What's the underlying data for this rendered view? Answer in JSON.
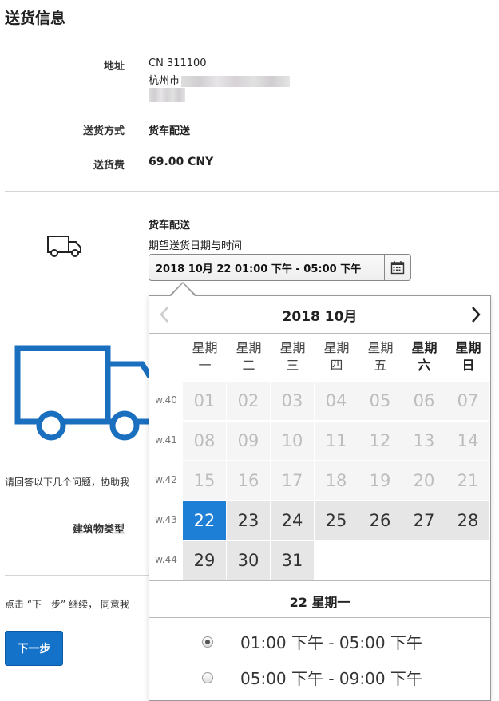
{
  "page": {
    "title": "送货信息"
  },
  "info": {
    "address_label": "地址",
    "address_line1": "CN 311100",
    "address_line2": "杭州市",
    "method_label": "送货方式",
    "method_value": "货车配送",
    "fee_label": "送货费",
    "fee_value": "69.00 CNY"
  },
  "delivery": {
    "heading": "货车配送",
    "subheading": "期望送货日期与时间",
    "selected_text": "2018 10月 22 01:00 下午 - 05:00 下午"
  },
  "survey": {
    "intro_text": "请回答以下几个问题，协助我",
    "building_label": "建筑物类型"
  },
  "footer": {
    "consent_text": "点击 “下一步” 继续， 同意我",
    "next_label": "下一步"
  },
  "calendar": {
    "month_label": "2018 10月",
    "weekdays": [
      {
        "l1": "星期",
        "l2": "一",
        "weekend": false
      },
      {
        "l1": "星期",
        "l2": "二",
        "weekend": false
      },
      {
        "l1": "星期",
        "l2": "三",
        "weekend": false
      },
      {
        "l1": "星期",
        "l2": "四",
        "weekend": false
      },
      {
        "l1": "星期",
        "l2": "五",
        "weekend": false
      },
      {
        "l1": "星期",
        "l2": "六",
        "weekend": true
      },
      {
        "l1": "星期",
        "l2": "日",
        "weekend": true
      }
    ],
    "weeks": [
      {
        "label": "w.40",
        "days": [
          {
            "n": "01",
            "s": "past"
          },
          {
            "n": "02",
            "s": "past"
          },
          {
            "n": "03",
            "s": "past"
          },
          {
            "n": "04",
            "s": "past"
          },
          {
            "n": "05",
            "s": "past"
          },
          {
            "n": "06",
            "s": "past"
          },
          {
            "n": "07",
            "s": "past"
          }
        ]
      },
      {
        "label": "w.41",
        "days": [
          {
            "n": "08",
            "s": "past"
          },
          {
            "n": "09",
            "s": "past"
          },
          {
            "n": "10",
            "s": "past"
          },
          {
            "n": "11",
            "s": "past"
          },
          {
            "n": "12",
            "s": "past"
          },
          {
            "n": "13",
            "s": "past"
          },
          {
            "n": "14",
            "s": "past"
          }
        ]
      },
      {
        "label": "w.42",
        "days": [
          {
            "n": "15",
            "s": "past"
          },
          {
            "n": "16",
            "s": "past"
          },
          {
            "n": "17",
            "s": "past"
          },
          {
            "n": "18",
            "s": "past"
          },
          {
            "n": "19",
            "s": "past"
          },
          {
            "n": "20",
            "s": "past"
          },
          {
            "n": "21",
            "s": "past"
          }
        ]
      },
      {
        "label": "w.43",
        "days": [
          {
            "n": "22",
            "s": "sel"
          },
          {
            "n": "23",
            "s": "avail"
          },
          {
            "n": "24",
            "s": "avail"
          },
          {
            "n": "25",
            "s": "avail"
          },
          {
            "n": "26",
            "s": "avail"
          },
          {
            "n": "27",
            "s": "avail"
          },
          {
            "n": "28",
            "s": "avail"
          }
        ]
      },
      {
        "label": "w.44",
        "days": [
          {
            "n": "29",
            "s": "avail"
          },
          {
            "n": "30",
            "s": "avail"
          },
          {
            "n": "31",
            "s": "avail"
          }
        ]
      }
    ],
    "selected_day_label": "22 星期一",
    "time_slots": [
      {
        "label": "01:00 下午 - 05:00 下午",
        "checked": true
      },
      {
        "label": "05:00 下午 - 09:00 下午",
        "checked": false
      }
    ]
  },
  "colors": {
    "accent": "#1473c8",
    "selected_day": "#1d7fd6",
    "truck": "#1b6fbf"
  }
}
